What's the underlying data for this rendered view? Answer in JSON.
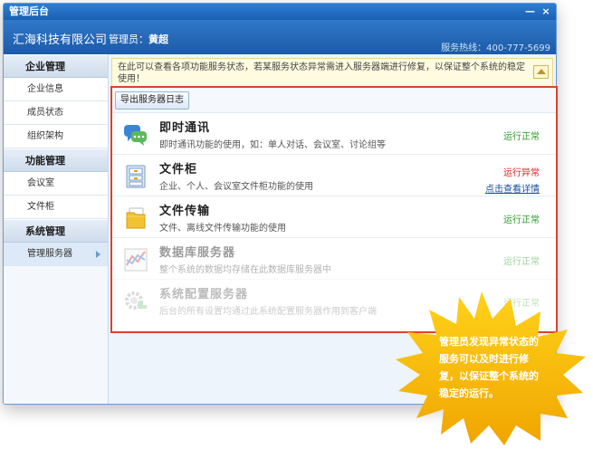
{
  "window": {
    "title": "管理后台",
    "controls": {
      "minimize": "—",
      "close": "×"
    }
  },
  "header": {
    "company": "汇海科技有限公司",
    "admin_label": "管理员：",
    "admin_name": "黄超",
    "hotline": "服务热线：400-777-5699"
  },
  "sidebar": {
    "groups": [
      {
        "label": "企业管理",
        "items": [
          "企业信息",
          "成员状态",
          "组织架构"
        ]
      },
      {
        "label": "功能管理",
        "items": [
          "会议室",
          "文件柜"
        ]
      },
      {
        "label": "系统管理",
        "items": [
          "管理服务器"
        ]
      }
    ]
  },
  "notice": {
    "text": "在此可以查看各项功能服务状态，若某服务状态异常需进入服务器端进行修复，以保证整个系统的稳定使用！"
  },
  "toolbar": {
    "export_label": "导出服务器日志"
  },
  "services": [
    {
      "name": "即时通讯",
      "desc": "即时通讯功能的使用，如：单人对话、会议室、讨论组等",
      "status": "运行正常",
      "icon": "chat-bubbles-icon"
    },
    {
      "name": "文件柜",
      "desc": "企业、个人、会议室文件柜功能的使用",
      "status": "运行异常",
      "link": "点击查看详情",
      "icon": "cabinet-icon"
    },
    {
      "name": "文件传输",
      "desc": "文件、离线文件传输功能的使用",
      "status": "运行正常",
      "icon": "folder-icon"
    },
    {
      "name": "数据库服务器",
      "desc": "整个系统的数据均存储在此数据库服务器中",
      "status": "运行正常",
      "icon": "chart-icon"
    },
    {
      "name": "系统配置服务器",
      "desc": "后台的所有设置均通过此系统配置服务器作用到客户端",
      "status": "运行正常",
      "icon": "gear-icon"
    }
  ],
  "callout": {
    "lines": [
      "管理员发现异常状态的",
      "服务可以及时进行修",
      "复，以保证整个系统的",
      "稳定的运行。"
    ]
  },
  "colors": {
    "accent": "#1b5fb2",
    "ok": "#2a9a2a",
    "error": "#e02020",
    "highlight_border": "#e0402a",
    "callout": "#f5b800"
  }
}
